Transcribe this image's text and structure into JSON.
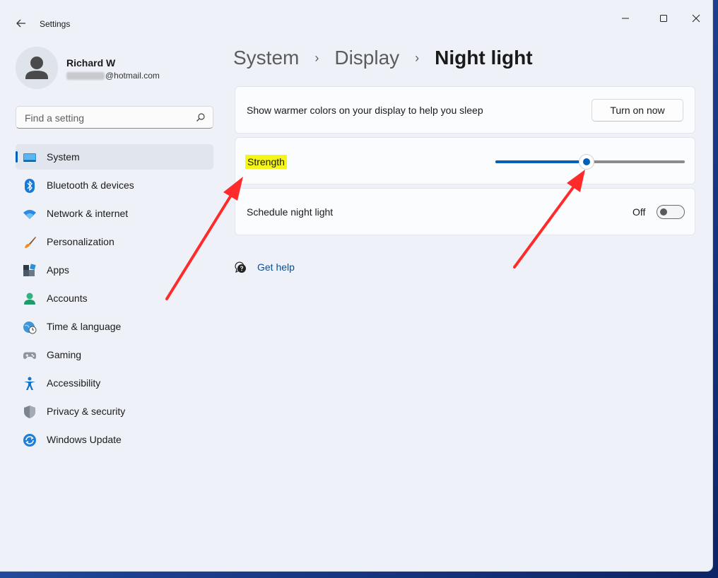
{
  "window": {
    "title": "Settings",
    "controls": [
      "minimize-icon",
      "maximize-icon",
      "close-icon"
    ]
  },
  "profile": {
    "name": "Richard W",
    "email_visible": "@hotmail.com"
  },
  "search": {
    "placeholder": "Find a setting",
    "value": ""
  },
  "sidebar": {
    "items": [
      {
        "label": "System",
        "icon": "system-display-icon",
        "active": true
      },
      {
        "label": "Bluetooth & devices",
        "icon": "bluetooth-icon"
      },
      {
        "label": "Network & internet",
        "icon": "wifi-icon"
      },
      {
        "label": "Personalization",
        "icon": "paintbrush-icon"
      },
      {
        "label": "Apps",
        "icon": "apps-icon"
      },
      {
        "label": "Accounts",
        "icon": "accounts-icon"
      },
      {
        "label": "Time & language",
        "icon": "clock-globe-icon"
      },
      {
        "label": "Gaming",
        "icon": "gamepad-icon"
      },
      {
        "label": "Accessibility",
        "icon": "accessibility-icon"
      },
      {
        "label": "Privacy & security",
        "icon": "shield-icon"
      },
      {
        "label": "Windows Update",
        "icon": "update-icon"
      }
    ]
  },
  "breadcrumb": {
    "items": [
      "System",
      "Display"
    ],
    "separator": "›",
    "current": "Night light"
  },
  "night_light": {
    "description": "Show warmer colors on your display to help you sleep",
    "turn_on_label": "Turn on now",
    "strength_label": "Strength",
    "strength_value": 0.48,
    "schedule_label": "Schedule night light",
    "schedule_state": "Off",
    "schedule_enabled": false
  },
  "help": {
    "label": "Get help"
  },
  "colors": {
    "accent": "#005fb8",
    "highlight": "#f5f51a",
    "annotation_arrow": "#ff2a2a"
  }
}
